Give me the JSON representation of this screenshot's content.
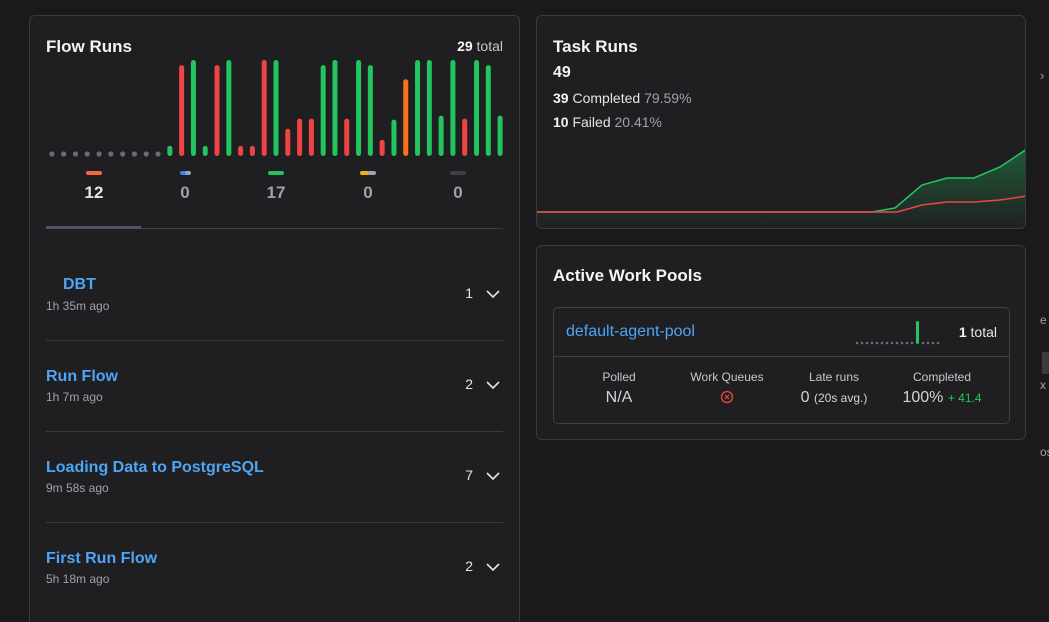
{
  "flow_runs": {
    "title": "Flow Runs",
    "total_count": "29",
    "total_label": "total",
    "chart_data": {
      "type": "bar",
      "values": [
        0,
        0,
        0,
        0,
        0,
        0,
        0,
        0,
        0,
        0,
        1,
        9,
        9.5,
        1,
        9,
        9.5,
        1,
        1,
        9.5,
        9.5,
        2.7,
        3.7,
        3.7,
        9,
        9.5,
        3.7,
        9.5,
        9,
        1.6,
        3.6,
        7.6,
        9.5,
        9.5,
        4,
        9.5,
        3.7,
        9.5,
        9,
        4
      ],
      "states": [
        "none",
        "none",
        "none",
        "none",
        "none",
        "none",
        "none",
        "none",
        "none",
        "none",
        "completed",
        "failed",
        "completed",
        "completed",
        "failed",
        "completed",
        "failed",
        "failed",
        "failed",
        "completed",
        "failed",
        "failed",
        "failed",
        "completed",
        "completed",
        "failed",
        "completed",
        "completed",
        "failed",
        "completed",
        "crashed",
        "completed",
        "completed",
        "completed",
        "completed",
        "failed",
        "completed",
        "completed",
        "completed"
      ]
    },
    "states": [
      {
        "name": "failed",
        "value": "12",
        "color": "#f5683f"
      },
      {
        "name": "running",
        "value": "0",
        "color": "#3b82f6"
      },
      {
        "name": "completed",
        "value": "17",
        "color": "#22c55e"
      },
      {
        "name": "pending",
        "value": "0",
        "color": "#eab308"
      },
      {
        "name": "cancelled",
        "value": "0",
        "color": "#52525b"
      }
    ],
    "rows": [
      {
        "name": "DBT",
        "time": "1h 35m ago",
        "count": "1"
      },
      {
        "name": "Run Flow",
        "time": "1h 7m ago",
        "count": "2"
      },
      {
        "name": "Loading Data to PostgreSQL",
        "time": "9m 58s ago",
        "count": "7"
      },
      {
        "name": "First Run Flow",
        "time": "5h 18m ago",
        "count": "2"
      }
    ]
  },
  "task_runs": {
    "title": "Task Runs",
    "total": "49",
    "completed_count": "39",
    "completed_label": "Completed",
    "completed_pct": "79.59%",
    "failed_count": "10",
    "failed_label": "Failed",
    "failed_pct": "20.41%",
    "colors": {
      "completed": "#22c55e",
      "failed": "#ef4444"
    }
  },
  "work_pools": {
    "title": "Active Work Pools",
    "pool": {
      "name": "default-agent-pool",
      "total_count": "1",
      "total_label": "total",
      "polled_label": "Polled",
      "polled_value": "N/A",
      "queues_label": "Work Queues",
      "queues_icon": "error-circle-icon",
      "late_label": "Late runs",
      "late_value": "0",
      "late_avg": "(20s avg.)",
      "completed_label": "Completed",
      "completed_value": "100%",
      "completed_delta": "+ 41.4"
    }
  },
  "edge_text": [
    "e",
    "x",
    "os"
  ]
}
